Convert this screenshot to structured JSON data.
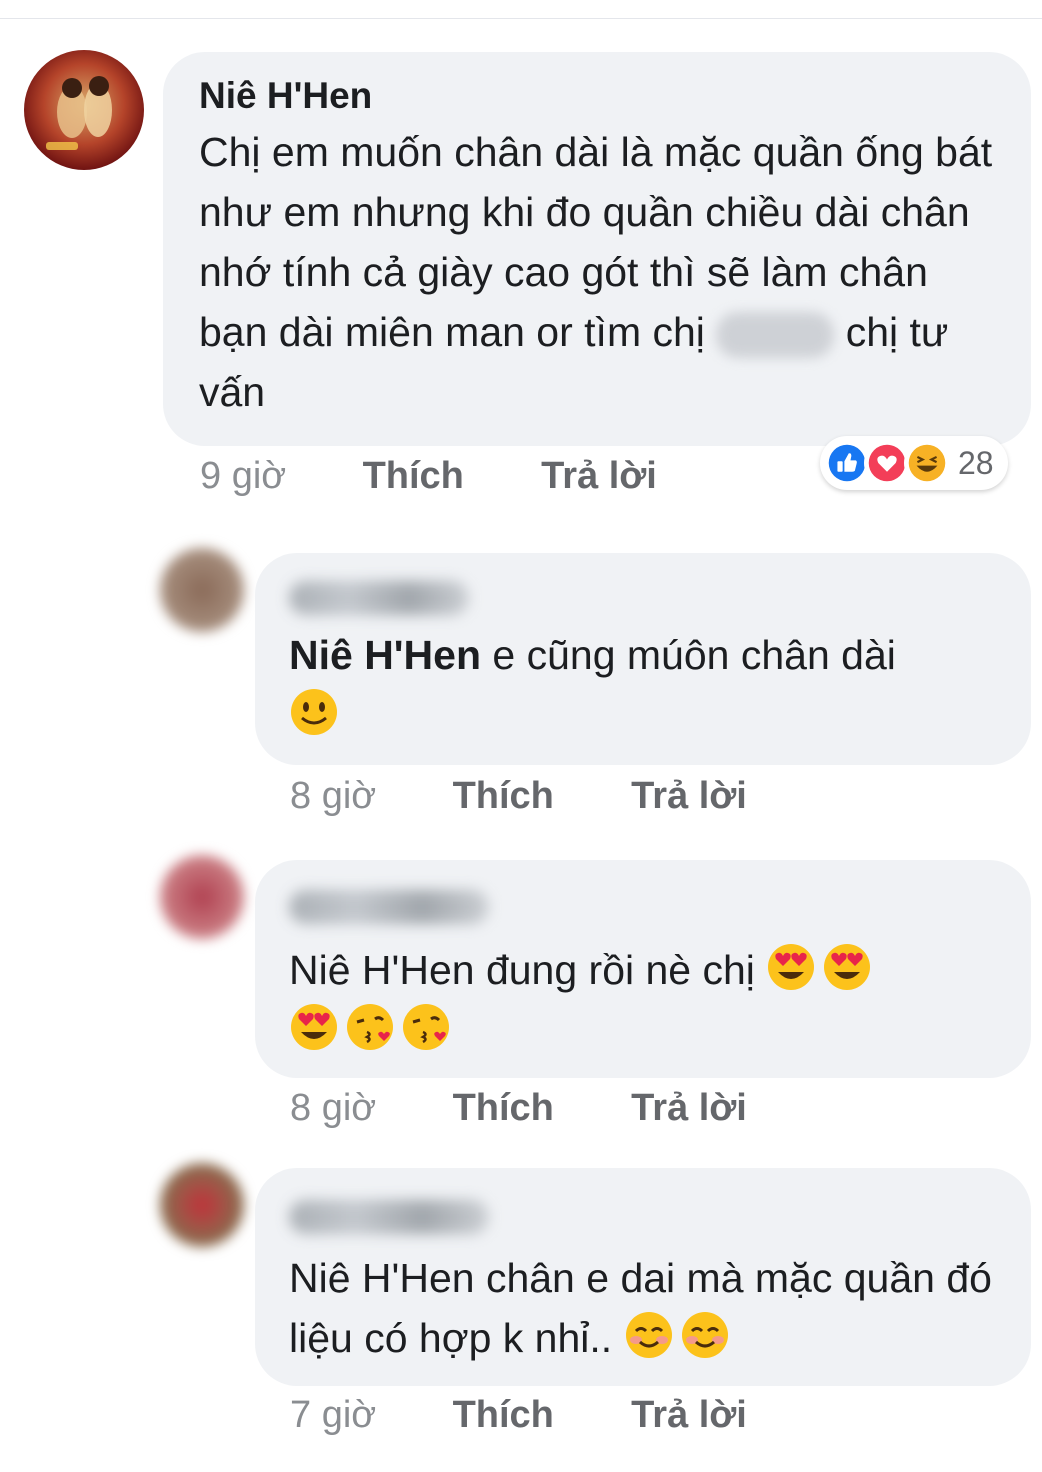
{
  "comments": [
    {
      "author": "Niê H'Hen",
      "text_part1": "Chị em muốn chân dài là mặc quần ống bát như em nhưng khi đo quần chiều dài chân nhớ tính cả giày cao gót thì sẽ làm chân bạn dài miên man or tìm chị",
      "text_part2": "chị tư vấn",
      "time": "9 giờ",
      "like": "Thích",
      "reply": "Trả lời",
      "reaction_count": "28"
    },
    {
      "mention": "Niê H'Hen",
      "text": " e cũng múôn chân dài",
      "time": "8 giờ",
      "like": "Thích",
      "reply": "Trả lời"
    },
    {
      "text": "Niê H'Hen đung rồi nè chị",
      "time": "8 giờ",
      "like": "Thích",
      "reply": "Trả lời"
    },
    {
      "text": "Niê H'Hen chân e dai mà mặc quần đó liệu có hợp k nhỉ..",
      "time": "7 giờ",
      "like": "Thích",
      "reply": "Trả lời"
    }
  ],
  "icons": [
    "like-icon",
    "love-icon",
    "haha-icon",
    "smile-emoji",
    "heart-eyes-emoji",
    "kiss-emoji",
    "blush-emoji"
  ],
  "colors": {
    "bubble": "#f0f2f5",
    "like_blue": "#1877f2",
    "love_red": "#f33e58",
    "haha_yellow": "#f7b125"
  }
}
